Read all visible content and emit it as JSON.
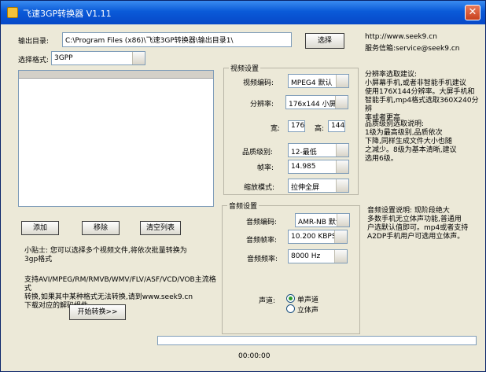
{
  "window": {
    "title": "飞速3GP转换器 V1.11",
    "close": "✕"
  },
  "output": {
    "label": "输出目录:",
    "path": "C:\\Program Files (x86)\\飞速3GP转换器\\输出目录1\\",
    "browse": "选择"
  },
  "format": {
    "label": "选择格式:",
    "value": "3GPP"
  },
  "contact": {
    "website": "http://www.seek9.cn",
    "email": "服务信箱:service@seek9.cn"
  },
  "video": {
    "group_title": "视频设置",
    "codec_label": "视频编码:",
    "codec_value": "MPEG4 默认",
    "resolution_label": "分辨率:",
    "resolution_value": "176x144 小屏",
    "width_label": "宽:",
    "width_value": "176",
    "height_label": "高:",
    "height_value": "144",
    "quality_label": "品质级别:",
    "quality_value": "12-最低",
    "fps_label": "帧率:",
    "fps_value": "14.985",
    "zoom_label": "缩放模式:",
    "zoom_value": "拉伸全屏"
  },
  "audio": {
    "group_title": "音频设置",
    "codec_label": "音频编码:",
    "codec_value": "AMR-NB 默认",
    "bitrate_label": "音频帧率:",
    "bitrate_value": "10.200 KBPS",
    "samplerate_label": "音频频率:",
    "samplerate_value": "8000 Hz",
    "channel_label": "声道:",
    "mono": "单声道",
    "stereo": "立体声"
  },
  "tips": {
    "resolution": "分辨率选取建议:\n小屏幕手机,或者非智能手机建议\n使用176X144分辨率。大屏手机和\n智能手机,mp4格式选取360X240分辨\n率或者更高",
    "quality": "品质级别选取说明:\n        1级为最高级别,品质依次\n下降,同样生成文件大小也随\n之减少。8级为基本清晰,建议\n选用6级。",
    "audio": "音频设置说明:    现阶段绝大\n多数手机无立体声功能,普通用\n户选默认值即可。mp4或者支持\nA2DP手机用户可选用立体声。"
  },
  "list_buttons": {
    "add": "添加",
    "remove": "移除",
    "clear": "清空列表"
  },
  "hint": "小贴士: 您可以选择多个视频文件,将依次批量转换为\n3gp格式",
  "support": "支持AVI/MPEG/RM/RMVB/WMV/FLV/ASF/VCD/VOB主流格式\n转换,如果其中某种格式无法转换,请到www.seek9.cn\n下载对应的解码组件。",
  "start_button": "开始转换>>",
  "progress": {
    "time": "00:00:00",
    "fraction": 0
  }
}
